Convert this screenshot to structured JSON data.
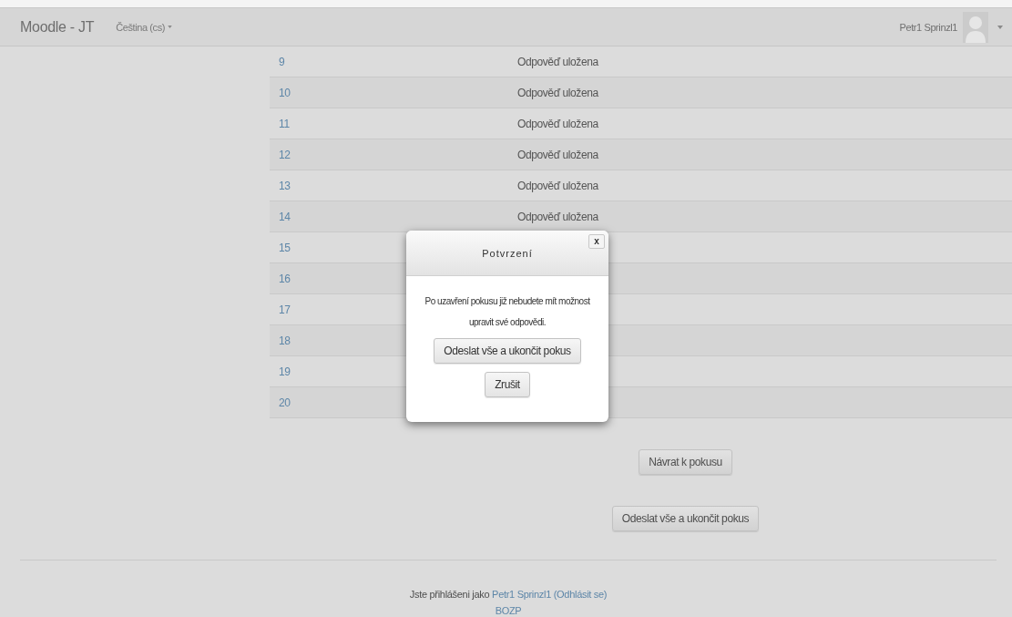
{
  "navbar": {
    "brand": "Moodle - JT",
    "language": "Čeština (cs)",
    "user": "Petr1 Sprinzl1"
  },
  "rows": [
    {
      "number": "9",
      "status": "Odpověď uložena"
    },
    {
      "number": "10",
      "status": "Odpověď uložena"
    },
    {
      "number": "11",
      "status": "Odpověď uložena"
    },
    {
      "number": "12",
      "status": "Odpověď uložena"
    },
    {
      "number": "13",
      "status": "Odpověď uložena"
    },
    {
      "number": "14",
      "status": "Odpověď uložena"
    },
    {
      "number": "15"
    },
    {
      "number": "16"
    },
    {
      "number": "17"
    },
    {
      "number": "18"
    },
    {
      "number": "19"
    },
    {
      "number": "20"
    }
  ],
  "buttons": [
    "Návrat k pokusu",
    "Odeslat vše a ukončit pokus"
  ],
  "footer": {
    "text": "Jste přihlášeni jako",
    "user_link": "Petr1 Sprinzl1",
    "logout_link": "(Odhlásit se)",
    "site_link": "BOZP"
  },
  "dialog": {
    "title": "Potvrzení",
    "close": "x",
    "message": "Po uzavření pokusu již nebudete mít možnost upravit své odpovědi.",
    "confirm": "Odeslat vše a ukončit pokus",
    "cancel": "Zrušit"
  }
}
